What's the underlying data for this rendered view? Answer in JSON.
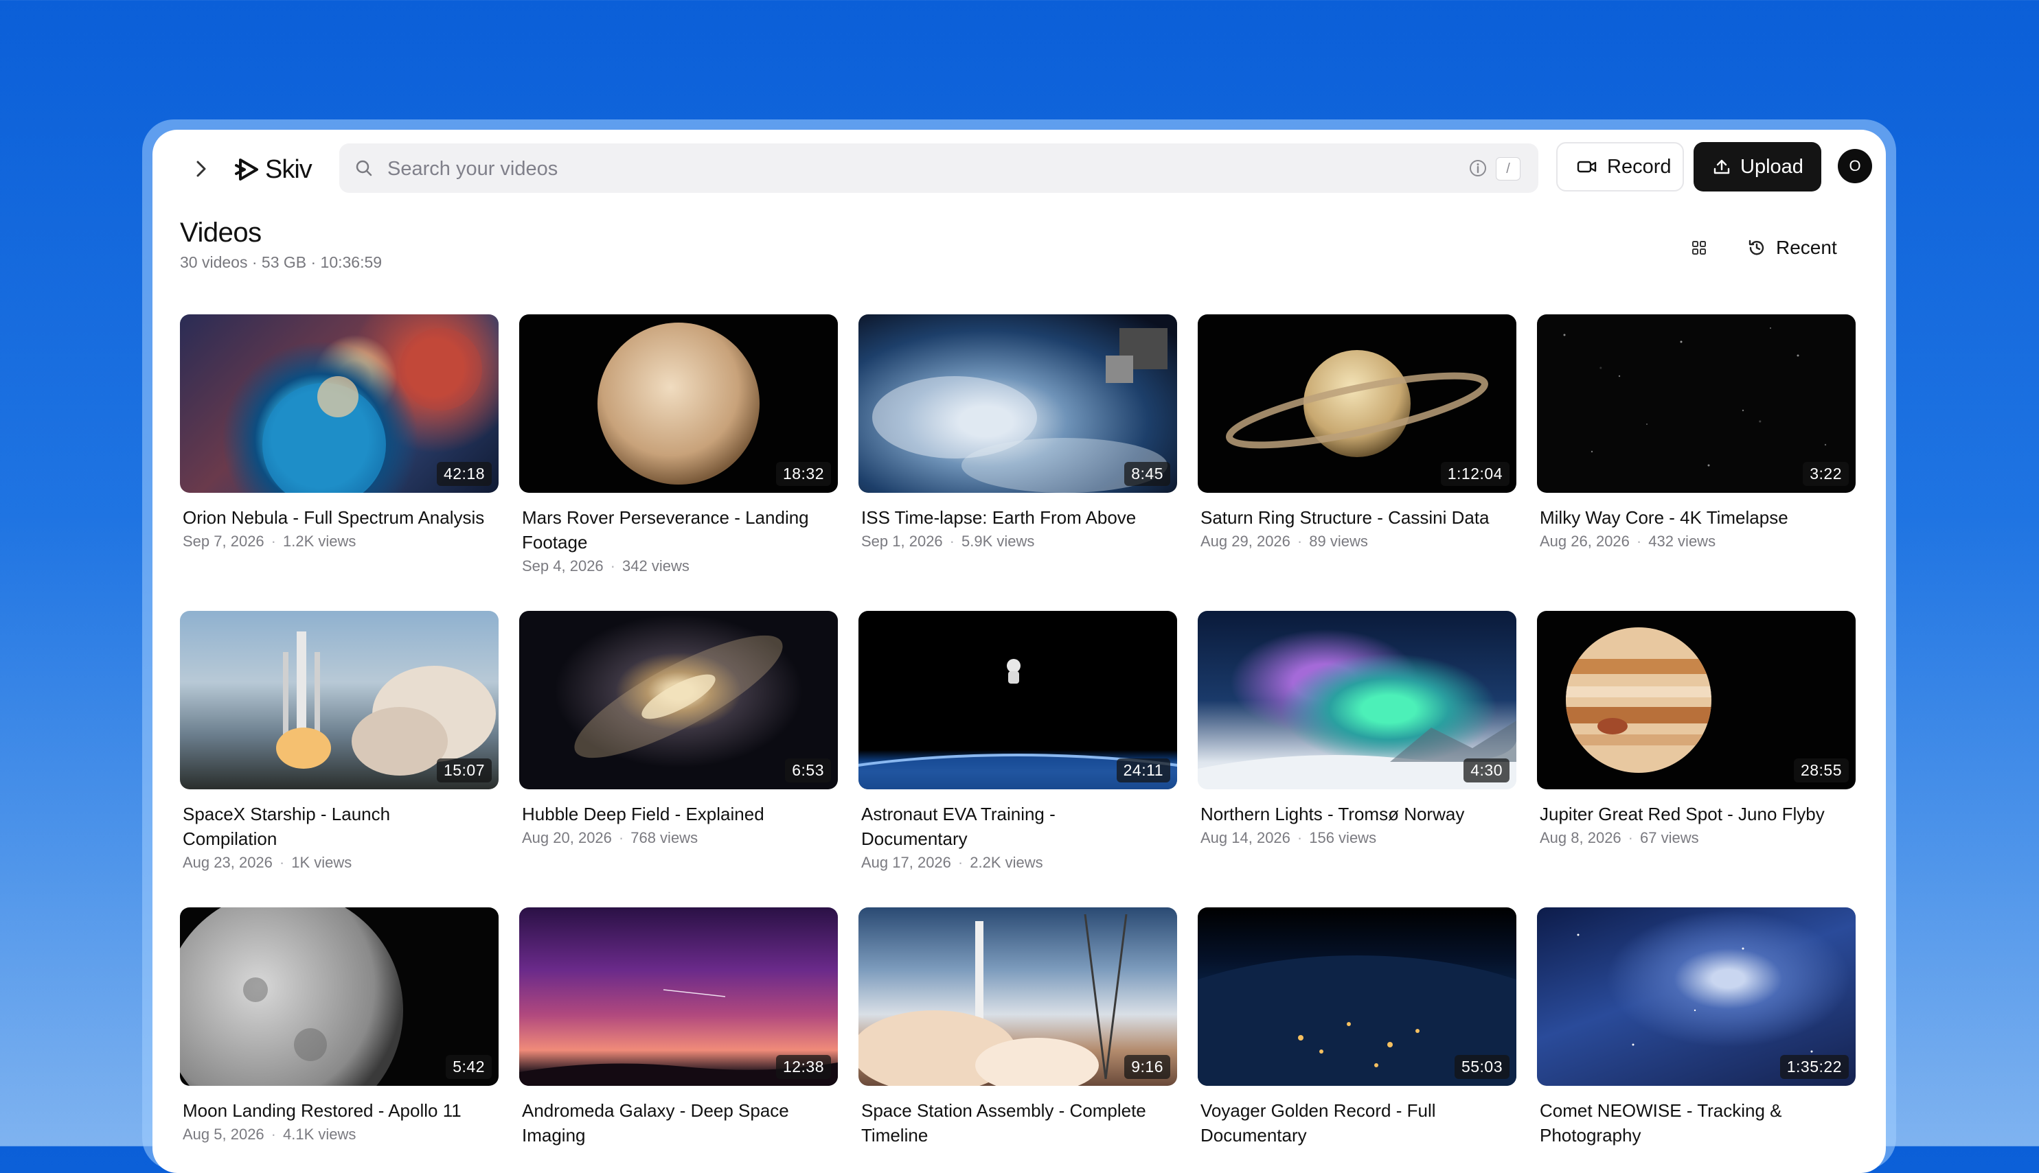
{
  "app": {
    "name": "Skiv"
  },
  "search": {
    "placeholder": "Search your videos",
    "shortcut": "/"
  },
  "header": {
    "record_label": "Record",
    "upload_label": "Upload",
    "avatar_initial": "O"
  },
  "page": {
    "title": "Videos",
    "stats": "30 videos · 53 GB · 10:36:59",
    "sort_label": "Recent"
  },
  "videos": [
    {
      "title": "Orion Nebula - Full Spectrum Analysis",
      "duration": "42:18",
      "date": "Sep 7, 2026",
      "views": "1.2K views"
    },
    {
      "title": "Mars Rover Perseverance - Landing Footage",
      "duration": "18:32",
      "date": "Sep 4, 2026",
      "views": "342 views"
    },
    {
      "title": "ISS Time-lapse: Earth From Above",
      "duration": "8:45",
      "date": "Sep 1, 2026",
      "views": "5.9K views"
    },
    {
      "title": "Saturn Ring Structure - Cassini Data",
      "duration": "1:12:04",
      "date": "Aug 29, 2026",
      "views": "89 views"
    },
    {
      "title": "Milky Way Core - 4K Timelapse",
      "duration": "3:22",
      "date": "Aug 26, 2026",
      "views": "432 views"
    },
    {
      "title": "SpaceX Starship - Launch Compilation",
      "duration": "15:07",
      "date": "Aug 23, 2026",
      "views": "1K views"
    },
    {
      "title": "Hubble Deep Field - Explained",
      "duration": "6:53",
      "date": "Aug 20, 2026",
      "views": "768 views"
    },
    {
      "title": "Astronaut EVA Training - Documentary",
      "duration": "24:11",
      "date": "Aug 17, 2026",
      "views": "2.2K views"
    },
    {
      "title": "Northern Lights - Tromsø Norway",
      "duration": "4:30",
      "date": "Aug 14, 2026",
      "views": "156 views"
    },
    {
      "title": "Jupiter Great Red Spot - Juno Flyby",
      "duration": "28:55",
      "date": "Aug 8, 2026",
      "views": "67 views"
    },
    {
      "title": "Moon Landing Restored - Apollo 11",
      "duration": "5:42",
      "date": "Aug 5, 2026",
      "views": "4.1K views"
    },
    {
      "title": "Andromeda Galaxy - Deep Space Imaging",
      "duration": "12:38",
      "date": "",
      "views": ""
    },
    {
      "title": "Space Station Assembly - Complete Timeline",
      "duration": "9:16",
      "date": "",
      "views": ""
    },
    {
      "title": "Voyager Golden Record - Full Documentary",
      "duration": "55:03",
      "date": "",
      "views": ""
    },
    {
      "title": "Comet NEOWISE - Tracking & Photography",
      "duration": "1:35:22",
      "date": "",
      "views": ""
    }
  ]
}
